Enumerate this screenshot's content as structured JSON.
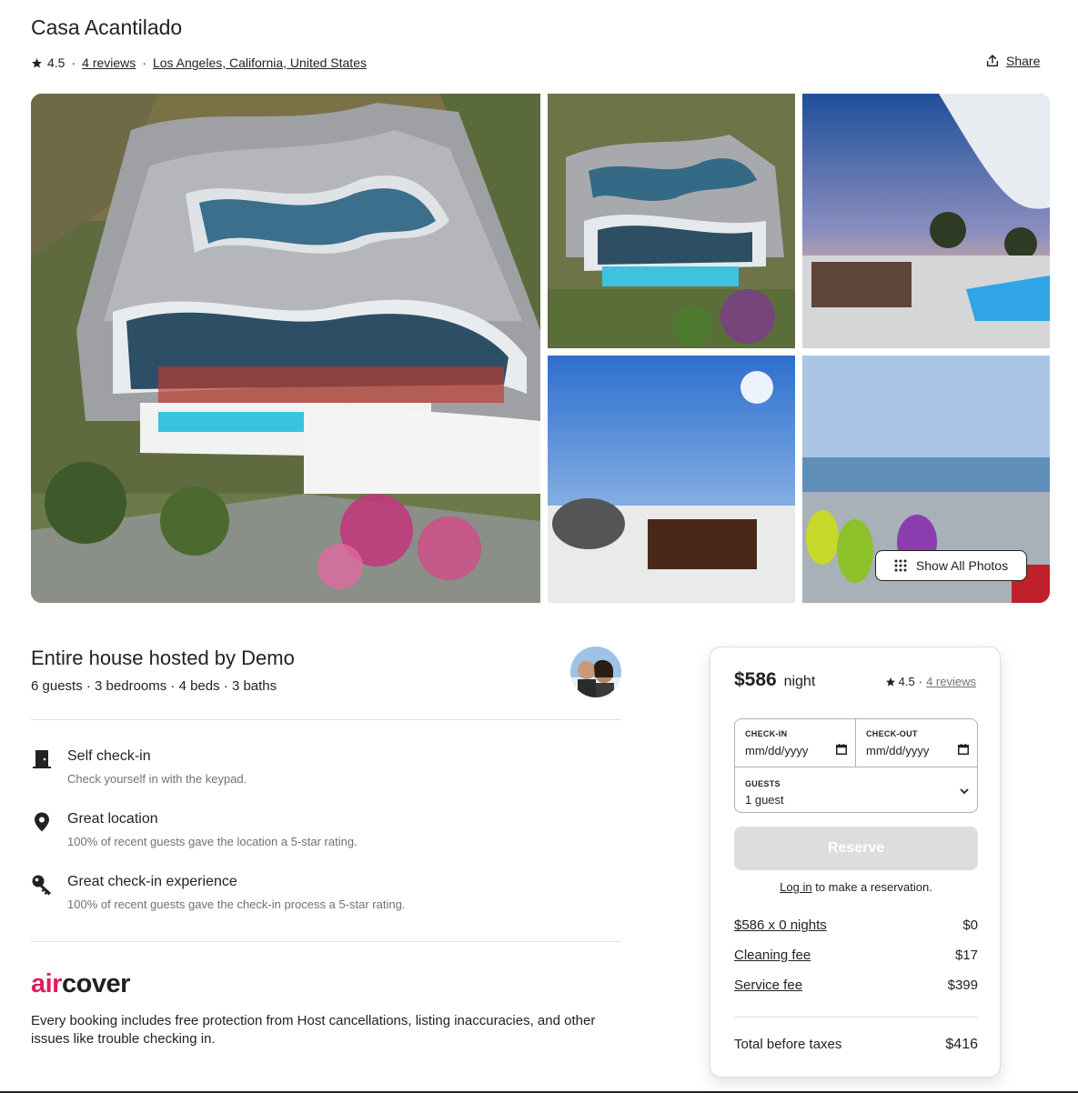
{
  "listing": {
    "title": "Casa Acantilado",
    "rating": "4.5",
    "reviews_label": "4 reviews",
    "location": "Los Angeles, California, United States",
    "share_label": "Share"
  },
  "gallery": {
    "show_all_label": "Show All Photos"
  },
  "host": {
    "title": "Entire house hosted by Demo",
    "summary": "6 guests · 3 bedrooms · 4 beds · 3 baths"
  },
  "features": [
    {
      "icon": "door-icon",
      "title": "Self check-in",
      "subtitle": "Check yourself in with the keypad."
    },
    {
      "icon": "location-pin-icon",
      "title": "Great location",
      "subtitle": "100% of recent guests gave the location a 5-star rating."
    },
    {
      "icon": "key-icon",
      "title": "Great check-in experience",
      "subtitle": "100% of recent guests gave the check-in process a 5-star rating."
    }
  ],
  "aircover": {
    "brand_air": "air",
    "brand_cover": "cover",
    "description": "Every booking includes free protection from Host cancellations, listing inaccuracies, and other issues like trouble checking in."
  },
  "booking": {
    "price": "$586",
    "per": "night",
    "rating": "4.5",
    "reviews_label": "4 reviews",
    "checkin_label": "CHECK-IN",
    "checkin_placeholder": "mm/dd/yyyy",
    "checkout_label": "CHECK-OUT",
    "checkout_placeholder": "mm/dd/yyyy",
    "guests_label": "GUESTS",
    "guests_value": "1 guest",
    "reserve_label": "Reserve",
    "login_link": "Log in",
    "login_note": " to make a reservation.",
    "lines": [
      {
        "label": "$586 x 0 nights",
        "amount": "$0"
      },
      {
        "label": "Cleaning fee",
        "amount": "$17"
      },
      {
        "label": "Service fee",
        "amount": "$399"
      }
    ],
    "total_label": "Total before taxes",
    "total_amount": "$416"
  },
  "colors": {
    "brand_pink": "#e31c5f",
    "text": "#222222",
    "muted": "#717171",
    "disabled_button": "#dddddd"
  }
}
